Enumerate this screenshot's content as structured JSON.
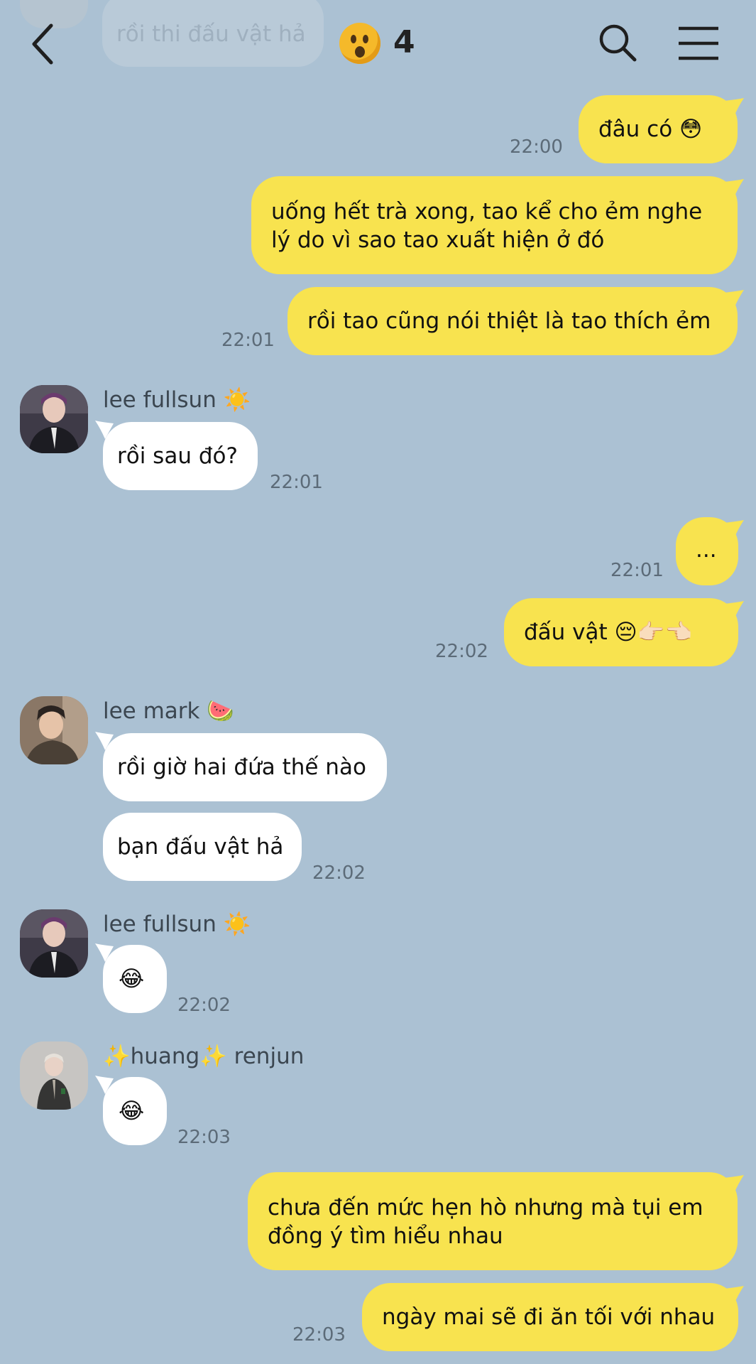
{
  "header": {
    "faded_message": "rồi thi đấu vật hả",
    "participant_count": "4"
  },
  "messages": [
    {
      "side": "out",
      "text": "đâu có 😳",
      "time": "22:00"
    },
    {
      "side": "out",
      "text": "uống hết trà xong, tao kể cho ẻm nghe",
      "text2": "lý do vì sao tao xuất hiện ở đó"
    },
    {
      "side": "out",
      "text": "rồi tao cũng nói thiệt là tao thích ẻm",
      "time": "22:01"
    },
    {
      "side": "in",
      "sender": "lee fullsun ☀️",
      "text": "rồi sau đó?",
      "time": "22:01"
    },
    {
      "side": "out",
      "text": "...",
      "time": "22:01"
    },
    {
      "side": "out",
      "text": "đấu vật 😔👉🏻👈🏻",
      "time": "22:02"
    },
    {
      "side": "in",
      "sender": "lee mark 🍉",
      "text": "rồi giờ hai đứa thế nào"
    },
    {
      "side": "in",
      "text": "bạn đấu vật hả",
      "time": "22:02"
    },
    {
      "side": "in",
      "sender": "lee fullsun ☀️",
      "text": "😂",
      "time": "22:02"
    },
    {
      "side": "in",
      "sender": "✨huang✨ renjun",
      "text": "😂",
      "time": "22:03"
    },
    {
      "side": "out",
      "text": "chưa đến mức hẹn hò nhưng mà tụi em",
      "text2": "đồng ý tìm hiểu nhau"
    },
    {
      "side": "out",
      "text": "ngày mai sẽ đi ăn tối với nhau",
      "time": "22:03"
    }
  ],
  "colors": {
    "background": "#abc1d3",
    "outgoing": "#f8e34f",
    "incoming": "#ffffff"
  },
  "icons": [
    "back-icon",
    "search-icon",
    "menu-icon"
  ]
}
